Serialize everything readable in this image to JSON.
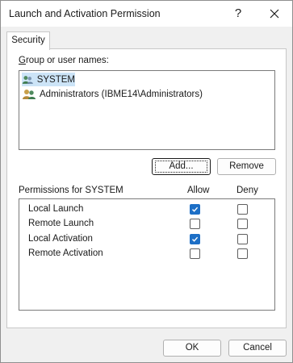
{
  "window": {
    "title": "Launch and Activation Permission",
    "help_label": "?",
    "close_icon": "close-icon"
  },
  "tabs": [
    {
      "label": "Security",
      "selected": true
    }
  ],
  "group": {
    "label": "Group or user names:",
    "items": [
      {
        "label": "SYSTEM",
        "icon": "users-icon",
        "selected": true
      },
      {
        "label": "Administrators (IBME14\\Administrators)",
        "icon": "users-icon",
        "selected": false
      }
    ],
    "add_label": "Add...",
    "remove_label": "Remove"
  },
  "permissions": {
    "label": "Permissions for SYSTEM",
    "allow_header": "Allow",
    "deny_header": "Deny",
    "rows": [
      {
        "name": "Local Launch",
        "allow": true,
        "deny": false
      },
      {
        "name": "Remote Launch",
        "allow": false,
        "deny": false
      },
      {
        "name": "Local Activation",
        "allow": true,
        "deny": false
      },
      {
        "name": "Remote Activation",
        "allow": false,
        "deny": false
      }
    ]
  },
  "footer": {
    "ok_label": "OK",
    "cancel_label": "Cancel"
  },
  "colors": {
    "accent": "#1d6fc6",
    "selection": "#cce4f7"
  }
}
